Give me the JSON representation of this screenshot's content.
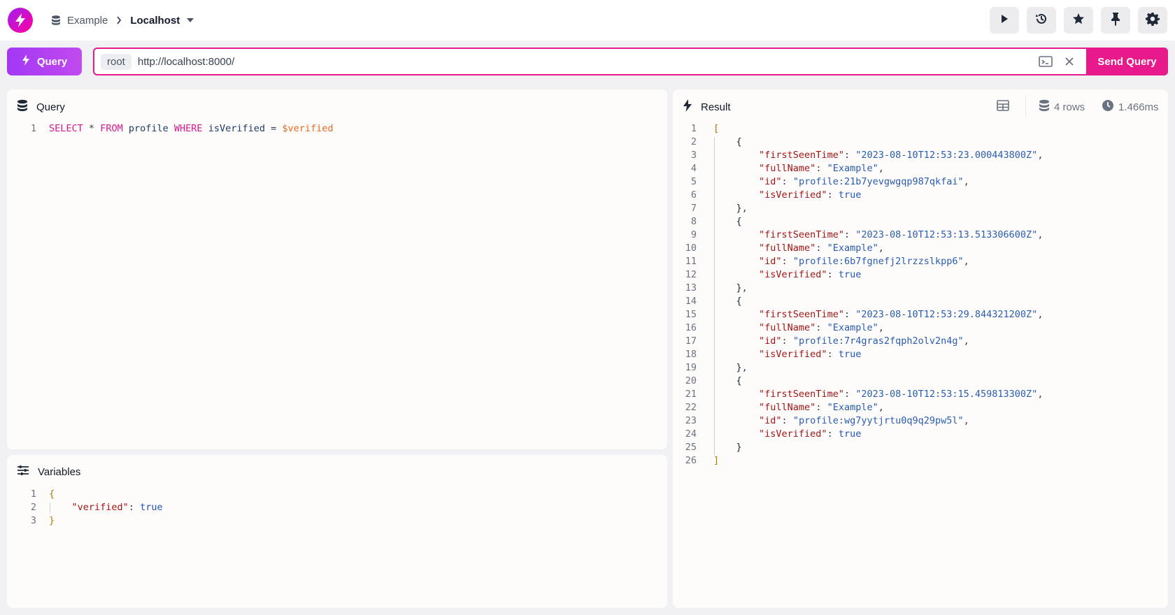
{
  "header": {
    "namespace": "Example",
    "database": "Localhost",
    "buttons": [
      "play-icon",
      "history-icon",
      "star-icon",
      "pin-icon",
      "gear-icon"
    ]
  },
  "toolbar": {
    "mode_label": "Query",
    "auth_label": "root",
    "url_value": "http://localhost:8000/",
    "send_label": "Send Query"
  },
  "query_panel": {
    "title": "Query",
    "line_numbers": "1",
    "lines": [
      "SELECT * FROM profile WHERE isVerified = $verified"
    ]
  },
  "variables_panel": {
    "title": "Variables",
    "line_numbers": "1\n2\n3",
    "lines": [
      "{",
      "    \"verified\": true",
      "}"
    ]
  },
  "result_panel": {
    "title": "Result",
    "rows_label": "4 rows",
    "time_label": "1.466ms",
    "line_numbers": "1\n2\n3\n4\n5\n6\n7\n8\n9\n10\n11\n12\n13\n14\n15\n16\n17\n18\n19\n20\n21\n22\n23\n24\n25\n26",
    "records": [
      {
        "firstSeenTime": "2023-08-10T12:53:23.000443800Z",
        "fullName": "Example",
        "id": "profile:21b7yevgwgqp987qkfai",
        "isVerified": "true"
      },
      {
        "firstSeenTime": "2023-08-10T12:53:13.513306600Z",
        "fullName": "Example",
        "id": "profile:6b7fgnefj2lrzzslkpp6",
        "isVerified": "true"
      },
      {
        "firstSeenTime": "2023-08-10T12:53:29.844321200Z",
        "fullName": "Example",
        "id": "profile:7r4gras2fqph2olv2n4g",
        "isVerified": "true"
      },
      {
        "firstSeenTime": "2023-08-10T12:53:15.459813300Z",
        "fullName": "Example",
        "id": "profile:wg7yytjrtu0q9q29pw5l",
        "isVerified": "true"
      }
    ]
  },
  "colors": {
    "accent": "#e8198b",
    "mode_gradient": "#a238f5",
    "keyword": "#d6188d",
    "json_key": "#a31515",
    "json_string": "#2a5db0"
  }
}
